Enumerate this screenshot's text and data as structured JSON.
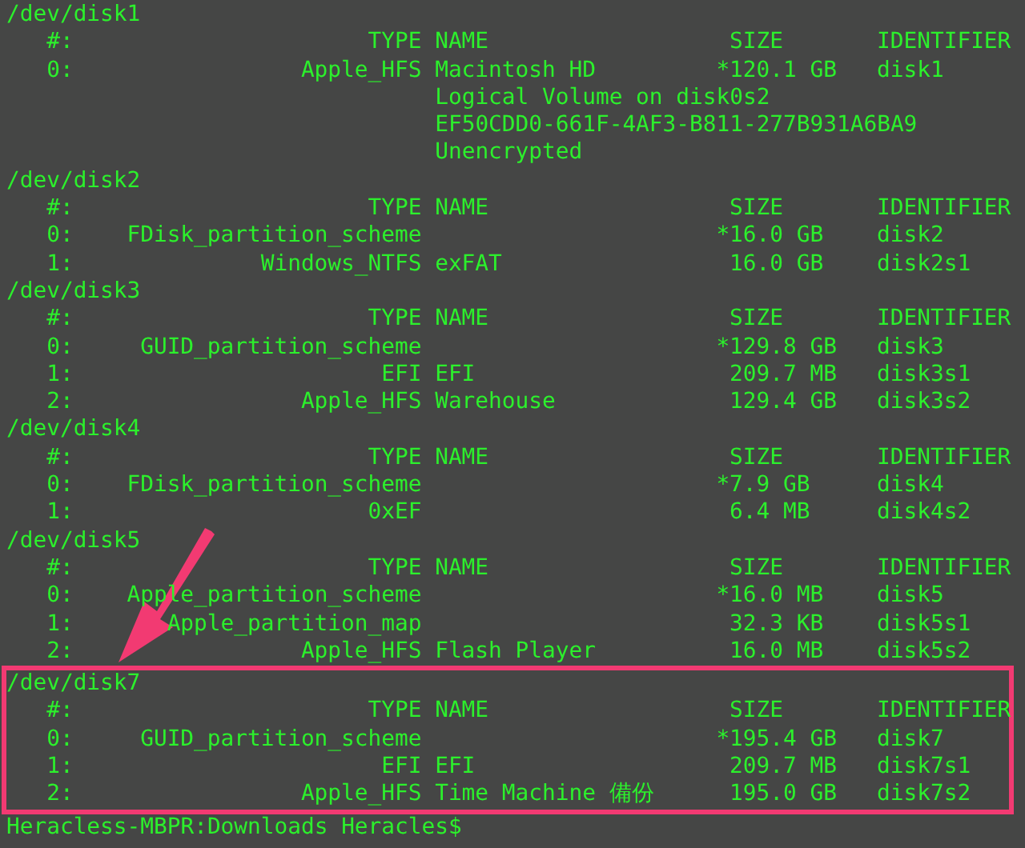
{
  "disks": [
    {
      "device": "/dev/disk1",
      "highlighted": false,
      "columns": [
        "#:",
        "TYPE",
        "NAME",
        "SIZE",
        "IDENTIFIER"
      ],
      "partitions": [
        {
          "number": "0:",
          "type": "Apple_HFS",
          "name": "Macintosh HD",
          "marker": "*",
          "size": "120.1 GB",
          "identifier": "disk1",
          "details": [
            "Logical Volume on disk0s2",
            "EF50CDD0-661F-4AF3-B811-277B931A6BA9",
            "Unencrypted"
          ]
        }
      ]
    },
    {
      "device": "/dev/disk2",
      "highlighted": false,
      "columns": [
        "#:",
        "TYPE",
        "NAME",
        "SIZE",
        "IDENTIFIER"
      ],
      "partitions": [
        {
          "number": "0:",
          "type": "FDisk_partition_scheme",
          "marker": "*",
          "size": "16.0 GB",
          "identifier": "disk2"
        },
        {
          "number": "1:",
          "type": "Windows_NTFS",
          "name": "exFAT",
          "size": "16.0 GB",
          "identifier": "disk2s1"
        }
      ]
    },
    {
      "device": "/dev/disk3",
      "highlighted": false,
      "columns": [
        "#:",
        "TYPE",
        "NAME",
        "SIZE",
        "IDENTIFIER"
      ],
      "partitions": [
        {
          "number": "0:",
          "type": "GUID_partition_scheme",
          "marker": "*",
          "size": "129.8 GB",
          "identifier": "disk3"
        },
        {
          "number": "1:",
          "type": "EFI",
          "name": "EFI",
          "size": "209.7 MB",
          "identifier": "disk3s1"
        },
        {
          "number": "2:",
          "type": "Apple_HFS",
          "name": "Warehouse",
          "size": "129.4 GB",
          "identifier": "disk3s2"
        }
      ]
    },
    {
      "device": "/dev/disk4",
      "highlighted": false,
      "columns": [
        "#:",
        "TYPE",
        "NAME",
        "SIZE",
        "IDENTIFIER"
      ],
      "partitions": [
        {
          "number": "0:",
          "type": "FDisk_partition_scheme",
          "marker": "*",
          "size": "7.9 GB",
          "identifier": "disk4"
        },
        {
          "number": "1:",
          "type": "0xEF",
          "size": "6.4 MB",
          "identifier": "disk4s2"
        }
      ]
    },
    {
      "device": "/dev/disk5",
      "highlighted": false,
      "columns": [
        "#:",
        "TYPE",
        "NAME",
        "SIZE",
        "IDENTIFIER"
      ],
      "partitions": [
        {
          "number": "0:",
          "type": "Apple_partition_scheme",
          "marker": "*",
          "size": "16.0 MB",
          "identifier": "disk5"
        },
        {
          "number": "1:",
          "type": "Apple_partition_map",
          "size": "32.3 KB",
          "identifier": "disk5s1"
        },
        {
          "number": "2:",
          "type": "Apple_HFS",
          "name": "Flash Player",
          "size": "16.0 MB",
          "identifier": "disk5s2"
        }
      ]
    },
    {
      "device": "/dev/disk7",
      "highlighted": true,
      "columns": [
        "#:",
        "TYPE",
        "NAME",
        "SIZE",
        "IDENTIFIER"
      ],
      "partitions": [
        {
          "number": "0:",
          "type": "GUID_partition_scheme",
          "marker": "*",
          "size": "195.4 GB",
          "identifier": "disk7"
        },
        {
          "number": "1:",
          "type": "EFI",
          "name": "EFI",
          "size": "209.7 MB",
          "identifier": "disk7s1"
        },
        {
          "number": "2:",
          "type": "Apple_HFS",
          "name": "Time Machine 備份",
          "size": "195.0 GB",
          "identifier": "disk7s2"
        }
      ]
    }
  ],
  "prompt": "Heracless-MBPR:Downloads Heracles$"
}
